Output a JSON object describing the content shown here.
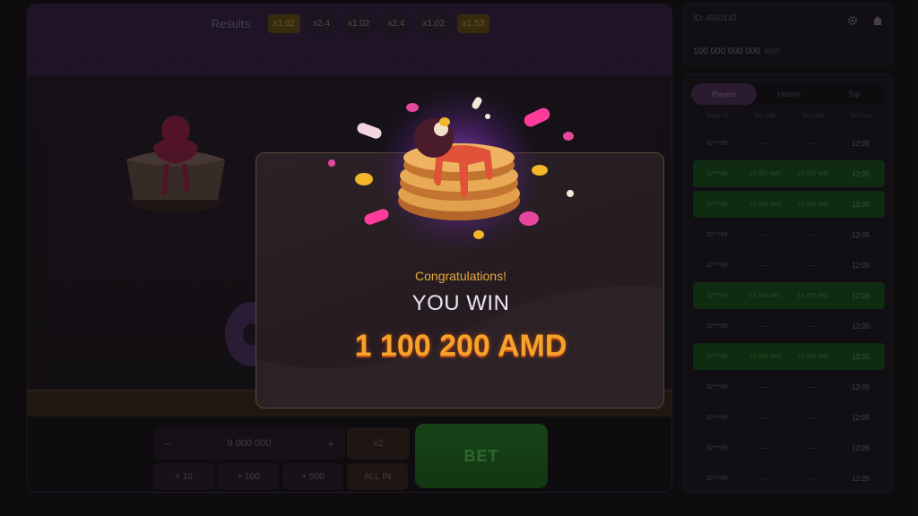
{
  "results": {
    "label": "Results:",
    "chips": [
      {
        "text": "x1.02",
        "gold": true
      },
      {
        "text": "x2.4",
        "gold": false
      },
      {
        "text": "x1.02",
        "gold": false
      },
      {
        "text": "x2.4",
        "gold": false
      },
      {
        "text": "x1.02",
        "gold": false
      },
      {
        "text": "x1.53",
        "gold": true
      }
    ]
  },
  "controls": {
    "minus": "−",
    "stake_value": "9 000 000",
    "plus": "+",
    "x2": "x2",
    "quick": [
      "+ 10",
      "+ 100",
      "+ 500"
    ],
    "all_in": "ALL IN",
    "bet": "BET"
  },
  "account": {
    "id": "ID: 4510142",
    "balance": "100 000 000 000",
    "currency": "AMD",
    "gear_icon": "gear-icon",
    "home_icon": "home-icon"
  },
  "bets_panel": {
    "tabs": [
      "Players",
      "History",
      "Top"
    ],
    "active_tab": 0,
    "headers": [
      "Player ID",
      "Bet AMD",
      "Win AMD",
      "Bet Time"
    ],
    "rows": [
      {
        "player": "32***99",
        "bet": "—",
        "win": "—",
        "time": "12:05",
        "win_row": false
      },
      {
        "player": "32***99",
        "bet": "15 497 845",
        "win": "15 497 845",
        "time": "12:05",
        "win_row": true
      },
      {
        "player": "32***99",
        "bet": "15 497 845",
        "win": "15 497 845",
        "time": "12:05",
        "win_row": true
      },
      {
        "player": "32***99",
        "bet": "—",
        "win": "—",
        "time": "12:05",
        "win_row": false
      },
      {
        "player": "32***99",
        "bet": "—",
        "win": "—",
        "time": "12:05",
        "win_row": false
      },
      {
        "player": "32***99",
        "bet": "15 497 845",
        "win": "15 497 845",
        "time": "12:05",
        "win_row": true
      },
      {
        "player": "32***99",
        "bet": "—",
        "win": "—",
        "time": "12:05",
        "win_row": false
      },
      {
        "player": "32***99",
        "bet": "15 497 845",
        "win": "15 497 845",
        "time": "12:05",
        "win_row": true
      },
      {
        "player": "32***99",
        "bet": "—",
        "win": "—",
        "time": "12:05",
        "win_row": false
      },
      {
        "player": "32***99",
        "bet": "—",
        "win": "—",
        "time": "12:05",
        "win_row": false
      },
      {
        "player": "32***99",
        "bet": "—",
        "win": "—",
        "time": "12:05",
        "win_row": false
      },
      {
        "player": "32***99",
        "bet": "—",
        "win": "—",
        "time": "12:05",
        "win_row": false
      }
    ]
  },
  "win_modal": {
    "congrats": "Congratulations!",
    "title": "YOU WIN",
    "amount": "1 100 200 AMD"
  },
  "colors": {
    "gold": "#f6a32a",
    "win_row": "#143a17",
    "bet_green": "#1f5a22"
  }
}
